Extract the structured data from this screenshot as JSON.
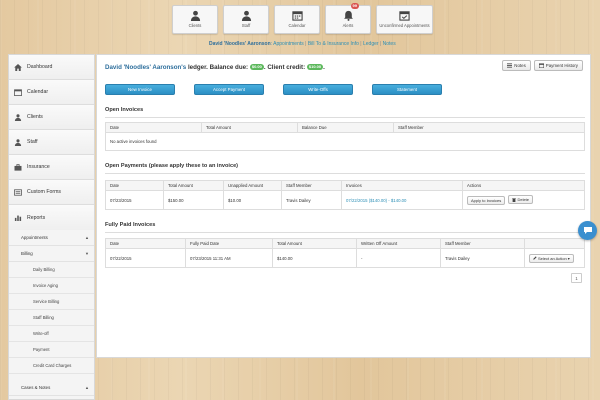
{
  "topnav": {
    "items": [
      {
        "label": "Clients",
        "icon": "person-icon"
      },
      {
        "label": "Staff",
        "icon": "person-icon"
      },
      {
        "label": "Calendar",
        "icon": "calendar-icon"
      },
      {
        "label": "Alerts",
        "icon": "bell-icon",
        "badge": "99"
      },
      {
        "label": "Unconfirmed Appointments",
        "icon": "calendar-check-icon"
      }
    ]
  },
  "breadcrumb": {
    "current": "David 'Noodles' Aaronson",
    "links": [
      ": Appointments",
      "Bill To & Insurance Info",
      "Ledger",
      "Notes"
    ],
    "separator": "|"
  },
  "sidebar": {
    "items": [
      {
        "label": "Dashboard",
        "icon": "home-icon"
      },
      {
        "label": "Calendar",
        "icon": "calendar-icon"
      },
      {
        "label": "Clients",
        "icon": "person-icon"
      },
      {
        "label": "Staff",
        "icon": "person-icon"
      },
      {
        "label": "Insurance",
        "icon": "briefcase-icon"
      },
      {
        "label": "Custom Forms",
        "icon": "forms-icon"
      }
    ],
    "reports": {
      "label": "Reports",
      "icon": "bar-chart-icon",
      "groups": [
        {
          "label": "Appointments",
          "caret": "▲"
        },
        {
          "label": "Billing",
          "caret": "▼"
        }
      ],
      "billing_items": [
        "Daily Billing",
        "Invoice Aging",
        "Service Billing",
        "Staff Billing",
        "Write-off",
        "Payment",
        "Credit Card Charges"
      ],
      "cases": {
        "label": "Cases & Notes",
        "caret": "▲"
      }
    }
  },
  "ledger": {
    "client_name": "David 'Noodles' Aaronson's",
    "ledger_text": "ledger. Balance due:",
    "balance_due": "$0.00",
    "credit_text": ". Client credit:",
    "client_credit": "$10.00",
    "end": ".",
    "notes_button": "Notes",
    "history_button": "Payment History"
  },
  "actions": [
    "New Invoice",
    "Accept Payment",
    "Write-Offs",
    "Statement"
  ],
  "open_invoices": {
    "title": "Open Invoices",
    "columns": [
      "Date",
      "Total Amount",
      "Balance Due",
      "Staff Member"
    ],
    "empty": "No active invoices found"
  },
  "open_payments": {
    "title": "Open Payments (please apply these to an invoice)",
    "columns": [
      "Date",
      "Total Amount",
      "Unapplied Amount",
      "Staff Member",
      "Invoices",
      "Actions"
    ],
    "rows": [
      {
        "date": "07/23/2015",
        "total": "$150.00",
        "unapplied": "$10.00",
        "staff": "Travis Dailey",
        "invoices": "07/22/2015 ($140.00) - $140.00",
        "apply": "Apply to Invoices",
        "delete": "Delete"
      }
    ]
  },
  "fully_paid": {
    "title": "Fully Paid Invoices",
    "columns": [
      "Date",
      "Fully Paid Date",
      "Total Amount",
      "Written Off Amount",
      "Staff Member",
      ""
    ],
    "rows": [
      {
        "date": "07/22/2015",
        "paid_date": "07/23/2015 11:31 AM",
        "total": "$140.00",
        "written_off": "-",
        "staff": "Travis Dailey",
        "action": "Select an Action"
      }
    ]
  },
  "pager": {
    "page": "1"
  },
  "colors": {
    "accent": "#2b8fc4",
    "link": "#2d8fb6",
    "badge": "#d9534f",
    "pill": "#5cb85c"
  }
}
